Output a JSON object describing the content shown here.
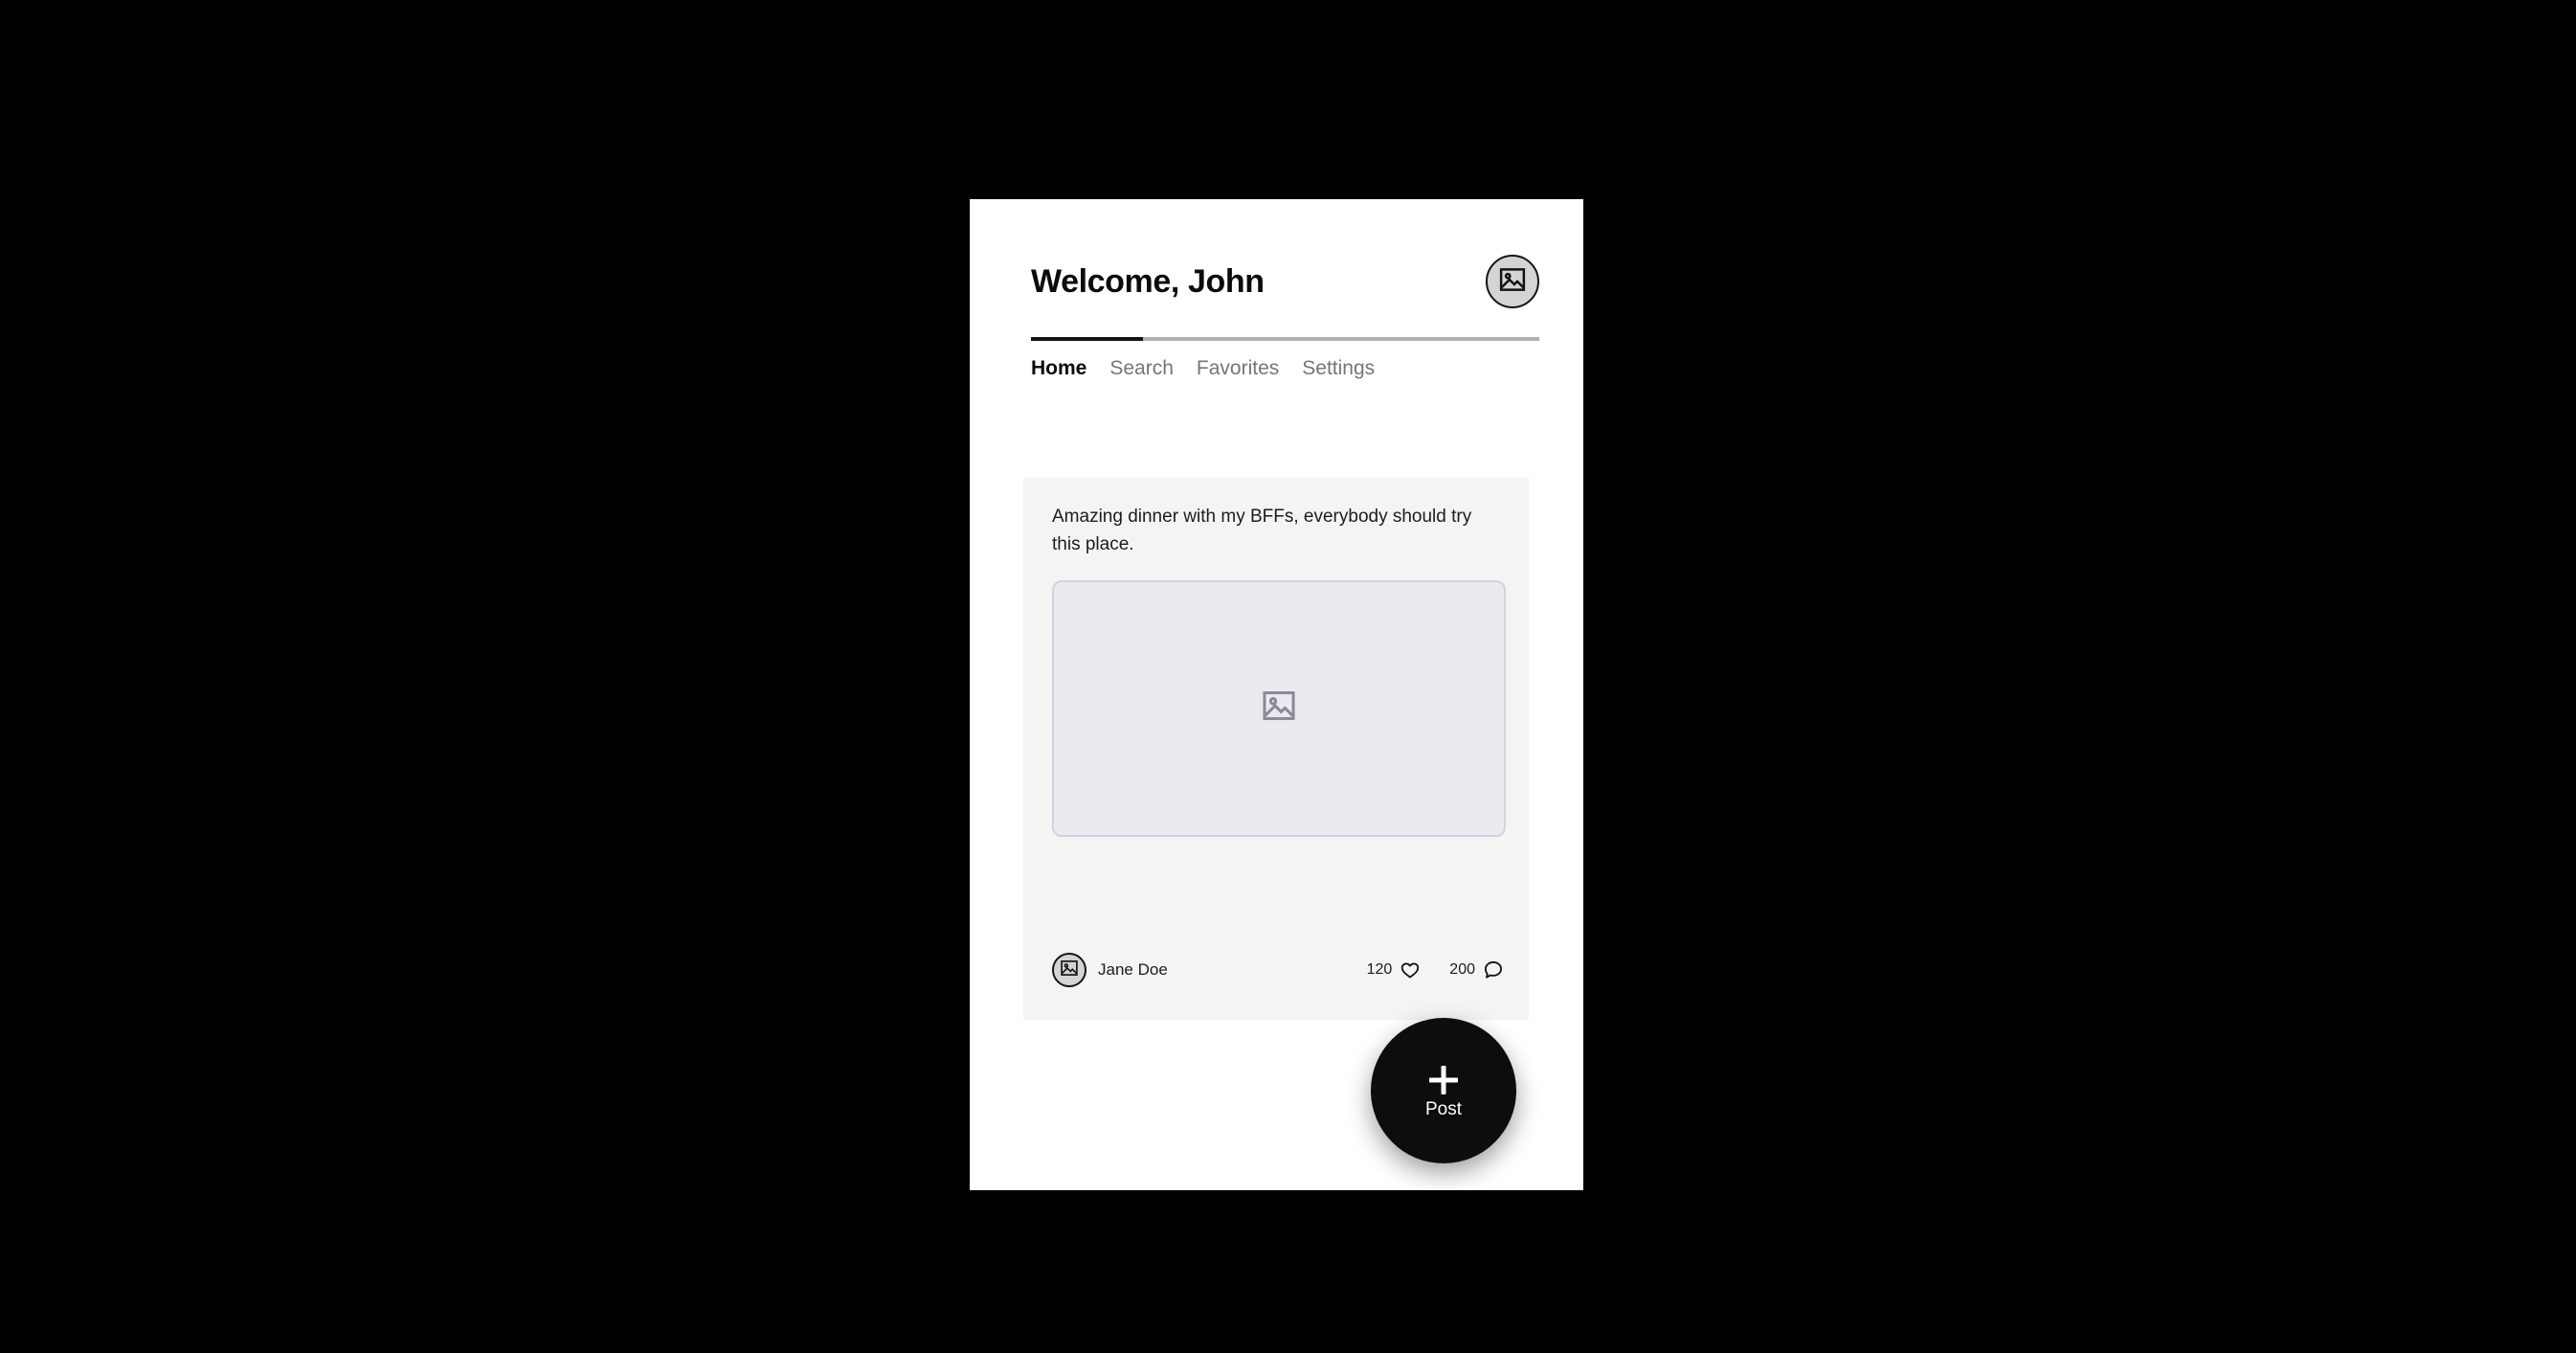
{
  "header": {
    "title": "Welcome, John",
    "avatar_icon": "image-placeholder-icon"
  },
  "tabs": {
    "active_index": 0,
    "items": [
      {
        "label": "Home"
      },
      {
        "label": "Search"
      },
      {
        "label": "Favorites"
      },
      {
        "label": "Settings"
      }
    ]
  },
  "post": {
    "text": "Amazing dinner with my BFFs, everybody should try this place.",
    "media_icon": "image-placeholder-icon",
    "author": {
      "name": "Jane Doe",
      "avatar_icon": "image-placeholder-icon"
    },
    "stats": {
      "likes": "120",
      "likes_icon": "heart-icon",
      "comments": "200",
      "comments_icon": "comment-bubble-icon"
    }
  },
  "fab": {
    "label": "Post",
    "icon": "plus-icon"
  },
  "colors": {
    "background": "#000000",
    "panel": "#ffffff",
    "card": "#f4f4f4",
    "accent": "#0d0d0d",
    "muted_text": "#757575",
    "media_fill": "#eaeaf0",
    "media_border": "#d3d3dd"
  }
}
